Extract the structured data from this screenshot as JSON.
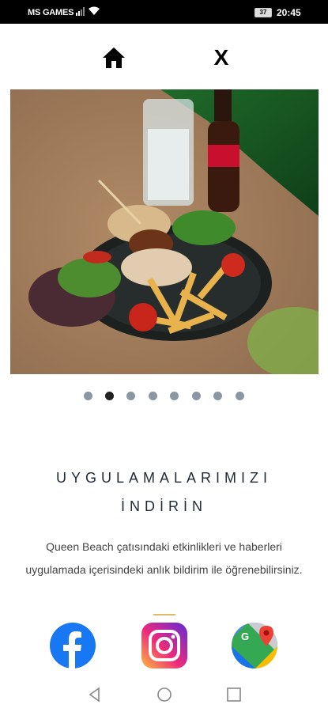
{
  "status_bar": {
    "carrier": "MS GAMES",
    "battery": "37",
    "time": "20:45"
  },
  "nav": {
    "home_icon": "home-icon",
    "close_label": "X"
  },
  "slider": {
    "image_description_icon": "food-photo",
    "slide_count": 8,
    "active_index": 1
  },
  "section": {
    "heading_line1": "UYGULAMALARIMIZI",
    "heading_line2": "İNDİRİN",
    "description": "Queen Beach çatısındaki etkinlikleri ve haberleri uygulamada içerisindeki anlık bildirim ile öğrenebilirsiniz."
  },
  "social": {
    "facebook_icon": "facebook-icon",
    "instagram_icon": "instagram-icon",
    "maps_icon": "google-maps-icon"
  },
  "colors": {
    "divider": "#e2b86b",
    "dot_inactive": "#8a97a3",
    "dot_active": "#222222",
    "facebook": "#1877f2"
  }
}
